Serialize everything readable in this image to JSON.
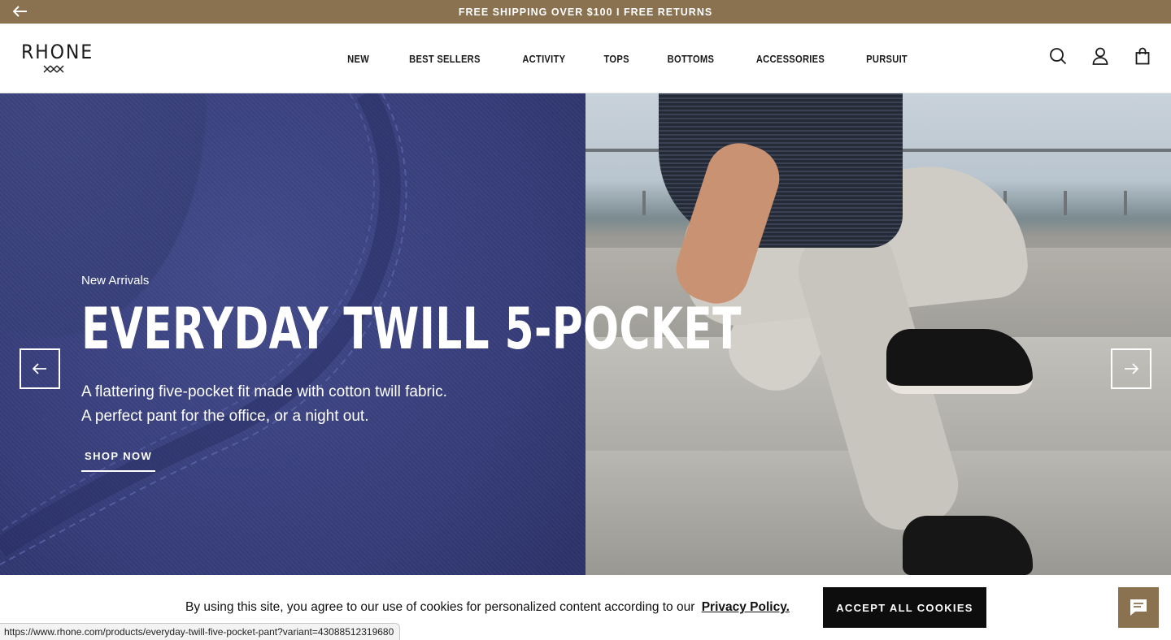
{
  "announcement": {
    "text": "FREE SHIPPING OVER $100 I FREE RETURNS",
    "back_icon": "arrow-left-icon"
  },
  "header": {
    "logo_text": "RHONE",
    "nav": [
      {
        "label": "NEW"
      },
      {
        "label": "BEST SELLERS"
      },
      {
        "label": "ACTIVITY"
      },
      {
        "label": "TOPS"
      },
      {
        "label": "BOTTOMS"
      },
      {
        "label": "ACCESSORIES"
      },
      {
        "label": "PURSUIT"
      }
    ],
    "icons": [
      "search-icon",
      "account-icon",
      "bag-icon"
    ]
  },
  "hero": {
    "eyebrow": "New Arrivals",
    "headline": "EVERYDAY TWILL 5-POCKET",
    "sub_line1": "A flattering five-pocket fit made with cotton twill fabric.",
    "sub_line2": "A perfect pant for the office, or a night out.",
    "cta": "SHOP NOW"
  },
  "cookie": {
    "text": "By using this site, you agree to our use of cookies for personalized content according to our",
    "link": "Privacy Policy.",
    "button": "ACCEPT ALL COOKIES"
  },
  "status_bar": {
    "url": "https://www.rhone.com/products/everyday-twill-five-pocket-pant?variant=43088512319680"
  },
  "colors": {
    "accent": "#8a7150",
    "announce_text": "#ffffff",
    "button_bg": "#0d0d0d"
  }
}
